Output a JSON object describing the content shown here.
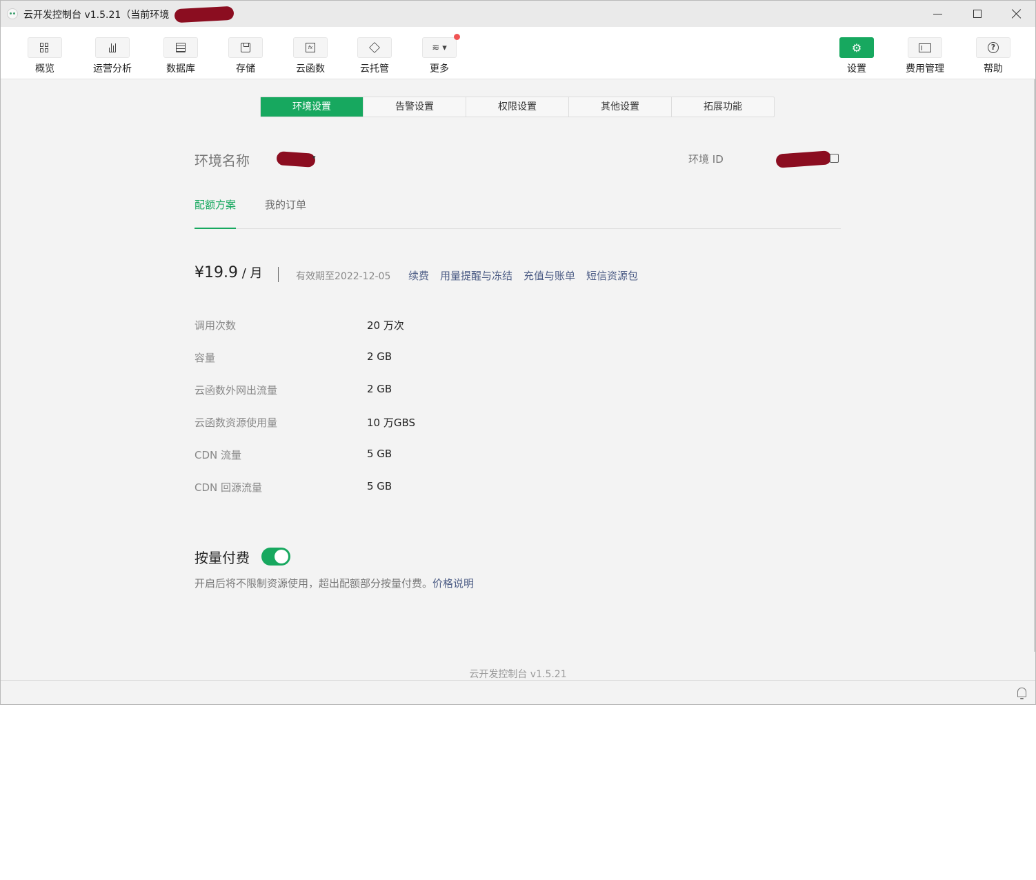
{
  "window": {
    "title": "云开发控制台 v1.5.21（当前环境"
  },
  "toolbar": {
    "items": [
      {
        "label": "概览",
        "icon": "grid-icon"
      },
      {
        "label": "运营分析",
        "icon": "bar-chart-icon"
      },
      {
        "label": "数据库",
        "icon": "database-icon"
      },
      {
        "label": "存储",
        "icon": "save-icon"
      },
      {
        "label": "云函数",
        "icon": "function-icon"
      },
      {
        "label": "云托管",
        "icon": "box-icon"
      },
      {
        "label": "更多",
        "icon": "layers-icon"
      }
    ],
    "right_items": [
      {
        "label": "设置",
        "icon": "gear-icon"
      },
      {
        "label": "费用管理",
        "icon": "wallet-icon"
      },
      {
        "label": "帮助",
        "icon": "help-icon"
      }
    ],
    "accent_color": "#17a85f",
    "notification_dot_color": "#f05454"
  },
  "tabs": [
    "环境设置",
    "告警设置",
    "权限设置",
    "其他设置",
    "拓展功能"
  ],
  "env": {
    "name_label": "环境名称",
    "id_label": "环境 ID"
  },
  "subtabs": [
    "配额方案",
    "我的订单"
  ],
  "plan": {
    "price": "¥19.9",
    "unit": " / 月",
    "validity": "有效期至2022-12-05",
    "links": [
      "续费",
      "用量提醒与冻结",
      "充值与账单",
      "短信资源包"
    ]
  },
  "quota": [
    {
      "label": "调用次数",
      "value": "20 万次"
    },
    {
      "label": "容量",
      "value": "2 GB"
    },
    {
      "label": "云函数外网出流量",
      "value": "2 GB"
    },
    {
      "label": "云函数资源使用量",
      "value": "10 万GBS"
    },
    {
      "label": "CDN 流量",
      "value": "5 GB"
    },
    {
      "label": "CDN 回源流量",
      "value": "5 GB"
    }
  ],
  "payg": {
    "title": "按量付费",
    "enabled": true,
    "description": "开启后将不限制资源使用，超出配额部分按量付费。",
    "link": "价格说明"
  },
  "footer": {
    "text": "云开发控制台 v1.5.21"
  },
  "link_color": "#4d5d86"
}
